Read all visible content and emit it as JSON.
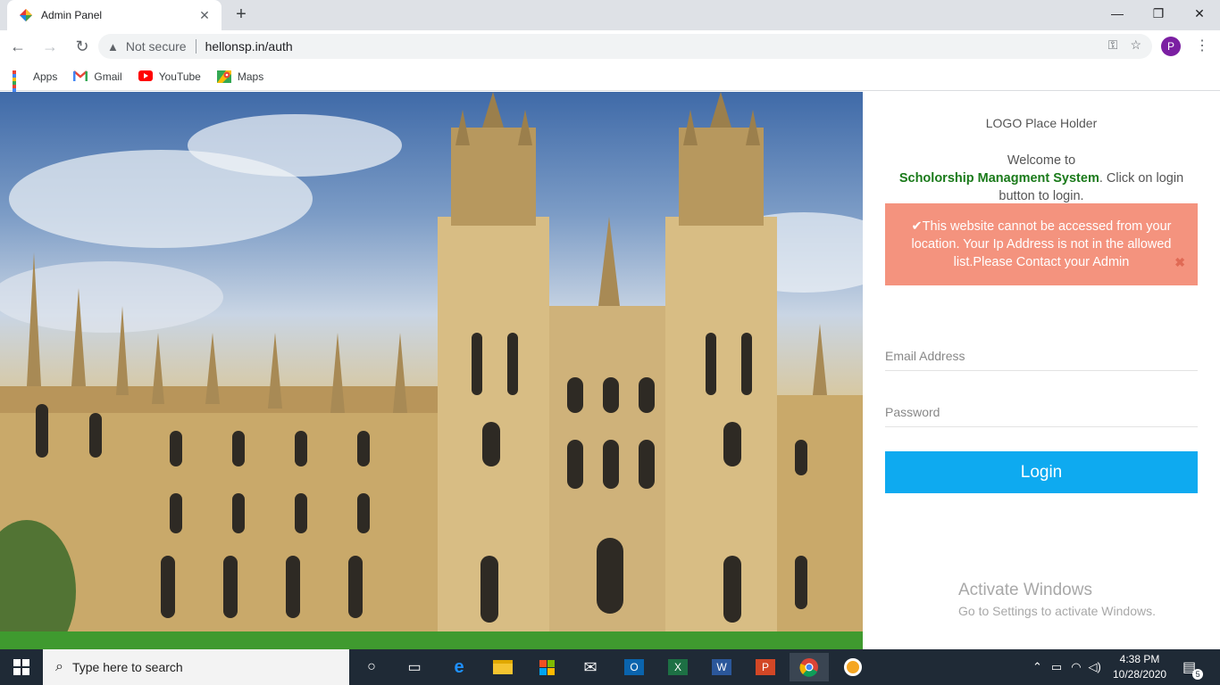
{
  "browser": {
    "tab_title": "Admin Panel",
    "tab_close": "✕",
    "new_tab": "+",
    "window_controls": {
      "minimize": "—",
      "restore": "❐",
      "close": "✕"
    },
    "nav": {
      "back": "←",
      "forward": "→",
      "reload": "↻"
    },
    "security_label": "Not secure",
    "url": "hellonsp.in/auth",
    "profile_initial": "P",
    "menu": "⋮",
    "key_icon": "⚿",
    "star_icon": "☆"
  },
  "bookmarks": [
    {
      "label": "Apps"
    },
    {
      "label": "Gmail"
    },
    {
      "label": "YouTube"
    },
    {
      "label": "Maps"
    }
  ],
  "login_panel": {
    "logo_placeholder": "LOGO Place Holder",
    "welcome_prefix": "Welcome to",
    "system_name": "Scholorship Managment System",
    "welcome_suffix": ". Click on login button to login.",
    "alert_text": "This website cannot be accessed from your location. Your Ip Address is not in the allowed list.Please Contact your Admin",
    "alert_icon": "✔",
    "alert_close": "✖",
    "email_placeholder": "Email Address",
    "password_placeholder": "Password",
    "login_label": "Login",
    "colors": {
      "alert_bg": "#f4937e",
      "login_bg": "#0eaaf0",
      "system_name": "#1a7a1a"
    }
  },
  "watermark": {
    "title": "Activate Windows",
    "subtitle": "Go to Settings to activate Windows."
  },
  "taskbar": {
    "search_placeholder": "Type here to search",
    "time": "4:38 PM",
    "date": "10/28/2020",
    "notification_count": "5",
    "apps": [
      "cortana-icon",
      "task-view-icon",
      "edge-icon",
      "file-explorer-icon",
      "store-icon",
      "mail-icon",
      "outlook-icon",
      "excel-icon",
      "word-icon",
      "powerpoint-icon",
      "chrome-icon",
      "vpn-icon"
    ]
  }
}
